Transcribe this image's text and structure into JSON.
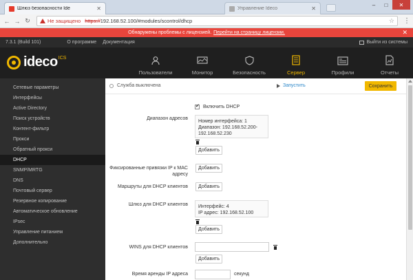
{
  "browser": {
    "tab_title": "Шлюз безопасности Ide",
    "tab2_title": "Управление Ideco",
    "url_insecure_label": "Не защищено",
    "url_scheme": "https://",
    "url_rest": "192.168.52.100/#modules/scontrol/dhcp"
  },
  "banner": {
    "text": "Обнаружены проблемы с лицензией.",
    "link": "Перейти на страницу лицензии."
  },
  "infobar": {
    "version": "7.3.1 (Build 101)",
    "about": "О программе",
    "docs": "Документация",
    "logout": "Выйти из системы"
  },
  "logo": {
    "text": "ideco",
    "sup": "ICS"
  },
  "nav": [
    {
      "label": "Пользователи",
      "icon": "users-icon"
    },
    {
      "label": "Монитор",
      "icon": "monitor-icon"
    },
    {
      "label": "Безопасность",
      "icon": "shield-icon"
    },
    {
      "label": "Сервер",
      "icon": "server-icon",
      "active": true
    },
    {
      "label": "Профили",
      "icon": "profile-icon"
    },
    {
      "label": "Отчеты",
      "icon": "report-icon"
    }
  ],
  "sidebar": [
    "Сетевые параметры",
    "Интерфейсы",
    "Active Directory",
    "Поиск устройств",
    "Контент-фильтр",
    "Прокси",
    "Обратный прокси",
    "DHCP",
    "SNMP/MRTG",
    "DNS",
    "Почтовый сервер",
    "Резервное копирование",
    "Автоматическое обновление",
    "IPsec",
    "Управление питанием",
    "Дополнительно"
  ],
  "sidebar_active": "DHCP",
  "content": {
    "status": "Служба выключена",
    "start": "Запустить",
    "save": "Сохранить",
    "enable_dhcp": "Включить DHCP",
    "enable_dhcp_checked": true,
    "range_label": "Диапазон адресов",
    "range_line1": "Номер интерфейса: 1",
    "range_line2": "Диапазон: 192.168.52.200-",
    "range_line3": "192.168.52.230",
    "add": "Добавить",
    "static_label_1": "Фиксированные привязки IP к MAC",
    "static_label_2": "адресу",
    "routes_label": "Маршруты для DHCP клиентов",
    "gateway_label": "Шлюз для DHCP клиентов",
    "gateway_line1": "Интерфейс: 4",
    "gateway_line2": "IP адрес: 192.168.52.100",
    "wins_label": "WINS для DHCP клиентов",
    "wins_value": "",
    "lease_label": "Время аренды IP адреса",
    "lease_suffix": "секунд"
  }
}
